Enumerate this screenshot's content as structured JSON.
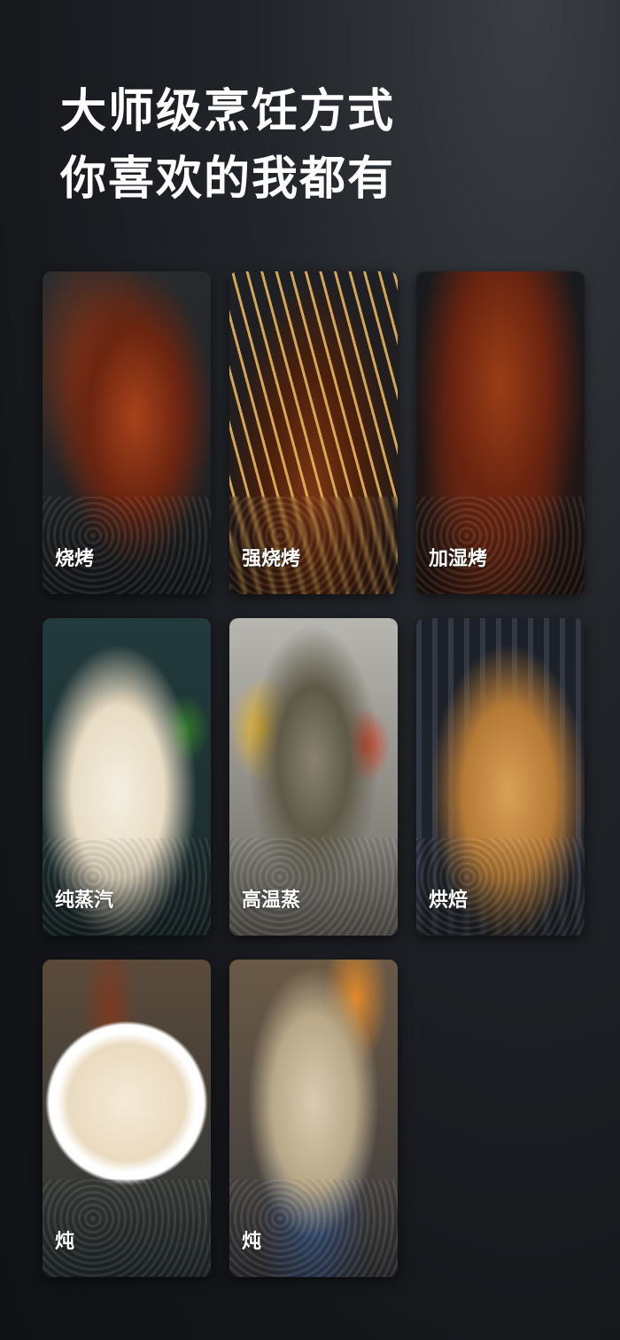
{
  "headline": {
    "line1": "大师级烹饪方式",
    "line2": "你喜欢的我都有"
  },
  "cards": [
    {
      "label": "烧烤",
      "image": "roasted-chicken-wings"
    },
    {
      "label": "强烧烤",
      "image": "meat-skewers"
    },
    {
      "label": "加湿烤",
      "image": "glazed-ribs"
    },
    {
      "label": "纯蒸汽",
      "image": "steamed-shrimp-rice"
    },
    {
      "label": "高温蒸",
      "image": "baked-fish-vegetables"
    },
    {
      "label": "烘焙",
      "image": "toast-sticks-basket"
    },
    {
      "label": "炖",
      "image": "white-fungus-soup"
    },
    {
      "label": "炖",
      "image": "stewed-pot"
    }
  ]
}
